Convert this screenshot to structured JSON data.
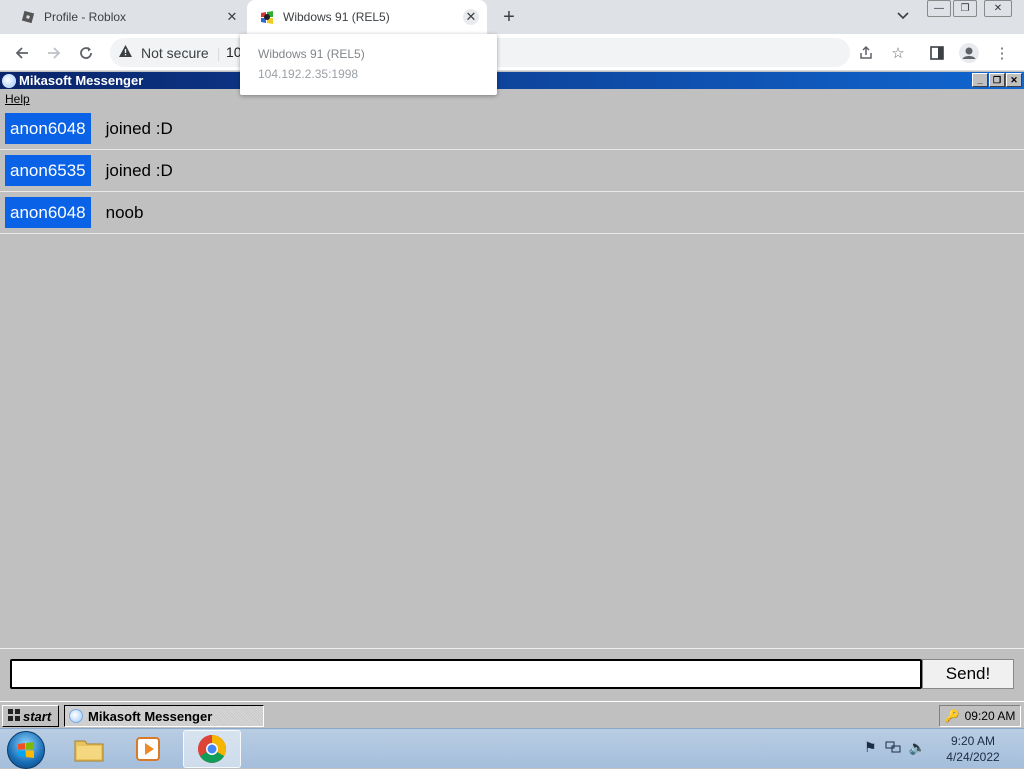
{
  "browser": {
    "tabs": [
      {
        "title": "Profile - Roblox",
        "icon": "roblox-icon",
        "active": false
      },
      {
        "title": "Wibdows 91 (REL5)",
        "icon": "windows91-icon",
        "active": true
      }
    ],
    "new_tab_icon": "plus-icon",
    "security_label": "Not secure",
    "url_fragment": "10",
    "hover_card": {
      "title": "Wibdows 91 (REL5)",
      "url": "104.192.2.35:1998"
    }
  },
  "app": {
    "title": "Mikasoft Messenger",
    "menu": [
      "Help"
    ],
    "messages": [
      {
        "user": "anon6048",
        "text": "joined :D"
      },
      {
        "user": "anon6535",
        "text": "joined :D"
      },
      {
        "user": "anon6048",
        "text": "noob"
      }
    ],
    "input": {
      "value": "",
      "placeholder": ""
    },
    "send_label": "Send!"
  },
  "w91_taskbar": {
    "start_label": "start",
    "window_label": "Mikasoft Messenger",
    "clock": "09:20 AM"
  },
  "os_taskbar": {
    "time": "9:20 AM",
    "date": "4/24/2022"
  },
  "colors": {
    "user_badge": "#0a62e6",
    "titlebar": "#0a246a",
    "desktop": "#c0c0c0"
  }
}
